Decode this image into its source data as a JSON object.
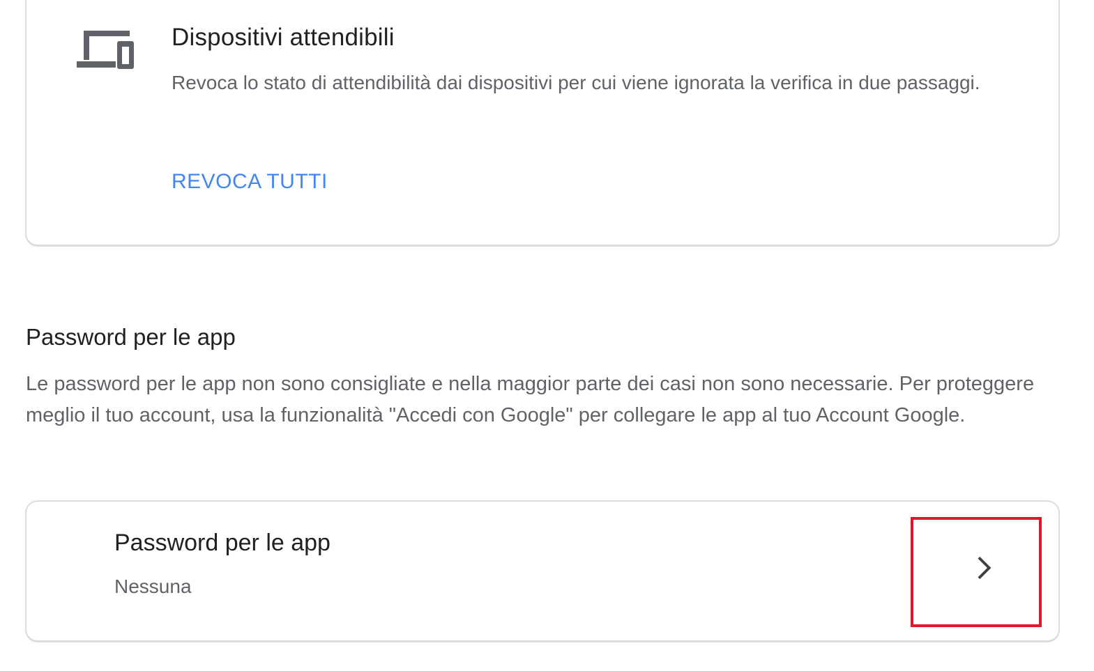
{
  "trusted_devices": {
    "title": "Dispositivi attendibili",
    "description": "Revoca lo stato di attendibilità dai dispositivi per cui viene ignorata la verifica in due passaggi.",
    "revoke_label": "REVOCA TUTTI",
    "icon": "devices-icon"
  },
  "app_passwords_section": {
    "title": "Password per le app",
    "description": "Le password per le app non sono consigliate e nella maggior parte dei casi non sono necessarie. Per proteggere meglio il tuo account, usa la funzionalità \"Accedi con Google\" per collegare le app al tuo Account Google."
  },
  "app_passwords_card": {
    "title": "Password per le app",
    "status": "Nessuna",
    "icon": "chevron-right-icon"
  },
  "colors": {
    "link": "#4285f4",
    "highlight": "#e0162b",
    "text_primary": "#202124",
    "text_secondary": "#5f6368"
  }
}
